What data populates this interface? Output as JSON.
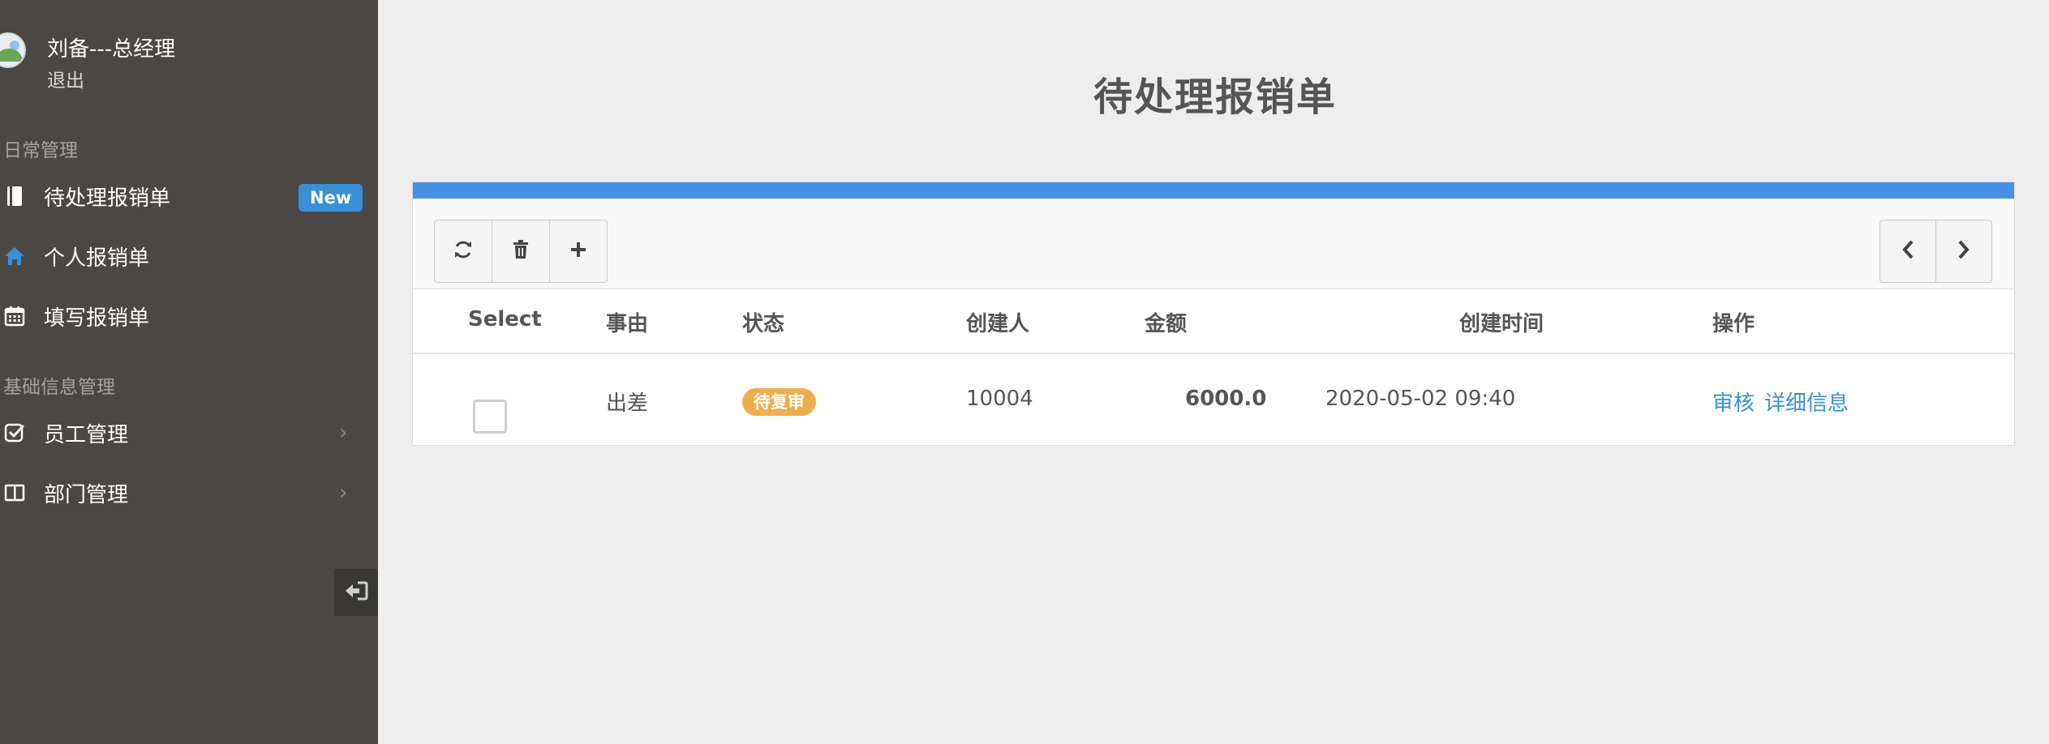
{
  "sidebar": {
    "profile": {
      "name": "刘备---总经理",
      "logout": "退出"
    },
    "sections": [
      {
        "title": "日常管理"
      },
      {
        "title": "基础信息管理"
      }
    ],
    "items": [
      {
        "label": "待处理报销单",
        "badge": "New",
        "icon": "book-icon"
      },
      {
        "label": "个人报销单",
        "icon": "home-icon"
      },
      {
        "label": "填写报销单",
        "icon": "calendar-icon"
      },
      {
        "label": "员工管理",
        "icon": "check-square-icon"
      },
      {
        "label": "部门管理",
        "icon": "columns-icon"
      }
    ],
    "colors": {
      "background": "#4a4744",
      "badge": "#3a8fd6"
    }
  },
  "main": {
    "title": "待处理报销单",
    "table": {
      "columns": [
        "Select",
        "事由",
        "状态",
        "创建人",
        "金额",
        "创建时间",
        "操作"
      ],
      "rows": [
        {
          "reason": "出差",
          "status": "待复审",
          "creator": "10004",
          "amount": "6000.0",
          "created_at": "2020-05-02 09:40",
          "actions": {
            "review": "审核",
            "details": "详细信息"
          }
        }
      ]
    },
    "toolbar": {
      "left_icons": [
        "refresh-icon",
        "trash-icon",
        "plus-icon"
      ],
      "right_icons": [
        "chevron-left-icon",
        "chevron-right-icon"
      ]
    },
    "colors": {
      "accent": "#4a90e2",
      "link": "#3a8fd6",
      "status_pending": "#f0ad4e"
    }
  }
}
